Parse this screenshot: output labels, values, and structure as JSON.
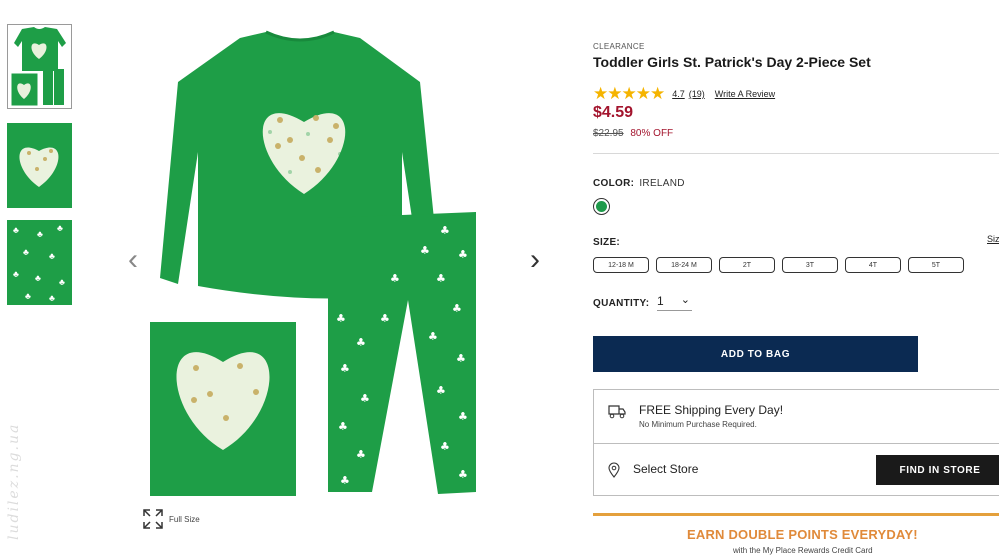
{
  "gallery": {
    "thumbnails": [
      "outfit-thumbnail",
      "heart-print-thumbnail",
      "shamrock-pattern-thumbnail"
    ],
    "fullsize_label": "Full Size",
    "watermark": "ludilez.ng.ua"
  },
  "product": {
    "badge": "CLEARANCE",
    "title": "Toddler Girls St. Patrick's Day 2-Piece Set",
    "rating_stars": "★★★★★",
    "rating_value": "4.7",
    "review_count": "(19)",
    "write_review": "Write A Review",
    "price": "$4.59",
    "original_price": "$22.95",
    "discount": "80% OFF"
  },
  "color": {
    "label": "COLOR:",
    "value": "IRELAND",
    "swatch_hex": "#1f9a4b"
  },
  "size": {
    "label": "SIZE:",
    "chart_link": "Size",
    "options": [
      "12-18 M",
      "18-24 M",
      "2T",
      "3T",
      "4T",
      "5T"
    ]
  },
  "quantity": {
    "label": "QUANTITY:",
    "value": "1"
  },
  "actions": {
    "add_to_bag": "ADD TO BAG"
  },
  "shipping": {
    "title": "FREE Shipping Every Day!",
    "subtitle": "No Minimum Purchase Required.",
    "select_store": "Select Store",
    "find_in_store": "FIND IN STORE"
  },
  "promo": {
    "headline": "EARN DOUBLE POINTS EVERYDAY!",
    "subline": "with the My Place Rewards Credit Card"
  },
  "colors": {
    "brand_green": "#1e9e47",
    "navy": "#0b2a52",
    "sale_red": "#a3142d",
    "promo_orange": "#e08a3a",
    "star_gold": "#f5b400"
  }
}
